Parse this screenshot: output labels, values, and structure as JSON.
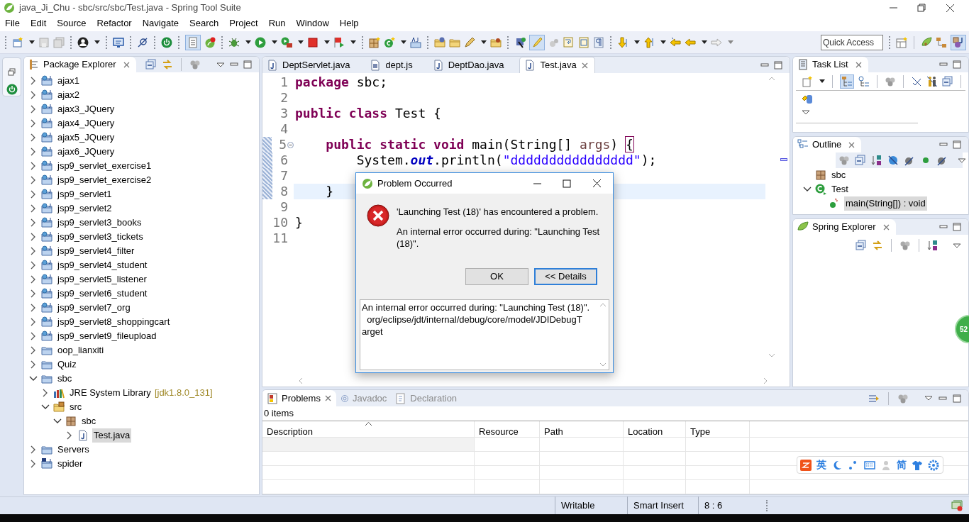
{
  "window": {
    "title": "java_Ji_Chu - sbc/src/sbc/Test.java - Spring Tool Suite"
  },
  "menu": [
    "File",
    "Edit",
    "Source",
    "Refactor",
    "Navigate",
    "Search",
    "Project",
    "Run",
    "Window",
    "Help"
  ],
  "quick_access": {
    "placeholder": "Quick Access"
  },
  "package_explorer": {
    "title": "Package Explorer",
    "tree": [
      {
        "label": "ajax1",
        "kind": "web_project",
        "expanded": false,
        "selected": false
      },
      {
        "label": "ajax2",
        "kind": "web_project",
        "expanded": false,
        "selected": false
      },
      {
        "label": "ajax3_JQuery",
        "kind": "web_project",
        "expanded": false,
        "selected": false
      },
      {
        "label": "ajax4_JQuery",
        "kind": "web_project",
        "expanded": false,
        "selected": false
      },
      {
        "label": "ajax5_JQuery",
        "kind": "web_project",
        "expanded": false,
        "selected": false
      },
      {
        "label": "ajax6_JQuery",
        "kind": "web_project",
        "expanded": false,
        "selected": false
      },
      {
        "label": "jsp9_servlet_exercise1",
        "kind": "web_project",
        "expanded": false,
        "selected": false
      },
      {
        "label": "jsp9_servlet_exercise2",
        "kind": "web_project",
        "expanded": false,
        "selected": false
      },
      {
        "label": "jsp9_servlet1",
        "kind": "web_project",
        "expanded": false,
        "selected": false
      },
      {
        "label": "jsp9_servlet2",
        "kind": "web_project",
        "expanded": false,
        "selected": false
      },
      {
        "label": "jsp9_servlet3_books",
        "kind": "web_project",
        "expanded": false,
        "selected": false
      },
      {
        "label": "jsp9_servlet3_tickets",
        "kind": "web_project",
        "expanded": false,
        "selected": false
      },
      {
        "label": "jsp9_servlet4_filter",
        "kind": "web_project",
        "expanded": false,
        "selected": false
      },
      {
        "label": "jsp9_servlet4_student",
        "kind": "web_project",
        "expanded": false,
        "selected": false
      },
      {
        "label": "jsp9_servlet5_listener",
        "kind": "web_project",
        "expanded": false,
        "selected": false
      },
      {
        "label": "jsp9_servlet6_student",
        "kind": "web_project",
        "expanded": false,
        "selected": false
      },
      {
        "label": "jsp9_servlet7_org",
        "kind": "web_project",
        "expanded": false,
        "selected": false
      },
      {
        "label": "jsp9_servlet8_shoppingcart",
        "kind": "web_project",
        "expanded": false,
        "selected": false
      },
      {
        "label": "jsp9_servlet9_fileupload",
        "kind": "web_project",
        "expanded": false,
        "selected": false
      },
      {
        "label": "oop_lianxiti",
        "kind": "project",
        "expanded": false,
        "selected": false
      },
      {
        "label": "Quiz",
        "kind": "project",
        "expanded": false,
        "selected": false
      },
      {
        "label": "sbc",
        "kind": "project",
        "expanded": true,
        "selected": false,
        "children": [
          {
            "label": "JRE System Library",
            "decoration": "[jdk1.8.0_131]",
            "kind": "library",
            "expanded": false,
            "selected": false
          },
          {
            "label": "src",
            "kind": "source_folder",
            "expanded": true,
            "selected": false,
            "children": [
              {
                "label": "sbc",
                "kind": "package",
                "expanded": true,
                "selected": false,
                "children": [
                  {
                    "label": "Test.java",
                    "kind": "java_file",
                    "expanded": false,
                    "selected": true
                  }
                ]
              }
            ]
          }
        ]
      },
      {
        "label": "Servers",
        "kind": "project",
        "expanded": false,
        "selected": false
      },
      {
        "label": "spider",
        "kind": "maven_project",
        "expanded": false,
        "selected": false
      }
    ]
  },
  "editor": {
    "tabs": [
      {
        "label": "DeptServlet.java",
        "kind": "java",
        "selected": false
      },
      {
        "label": "dept.js",
        "kind": "js",
        "selected": false
      },
      {
        "label": "DeptDao.java",
        "kind": "java",
        "selected": false
      },
      {
        "label": "Test.java",
        "kind": "java",
        "selected": true
      }
    ],
    "lines": [
      {
        "number": "1",
        "tokens": [
          {
            "kind": "keyword",
            "text": "package"
          },
          {
            "kind": "plain",
            "text": " sbc;"
          }
        ]
      },
      {
        "number": "2"
      },
      {
        "number": "3",
        "tokens": [
          {
            "kind": "keyword",
            "text": "public class"
          },
          {
            "kind": "plain",
            "text": " Test {"
          }
        ]
      },
      {
        "number": "4"
      },
      {
        "number": "5",
        "fold": true,
        "changed": true,
        "tokens": [
          {
            "kind": "keyword",
            "text": "    public static void"
          },
          {
            "kind": "plain",
            "text": " main(String[] "
          },
          {
            "kind": "param",
            "text": "args"
          },
          {
            "kind": "plain",
            "text": ") "
          },
          {
            "kind": "bracket",
            "text": "{"
          }
        ]
      },
      {
        "number": "6",
        "changed": true,
        "tokens": [
          {
            "kind": "plain",
            "text": "        System."
          },
          {
            "kind": "field",
            "text": "out"
          },
          {
            "kind": "plain",
            "text": ".println("
          },
          {
            "kind": "string",
            "text": "\"dddddddddddddddd\""
          },
          {
            "kind": "plain",
            "text": ");"
          }
        ]
      },
      {
        "number": "7",
        "changed": true
      },
      {
        "number": "8",
        "current": true,
        "changed": true,
        "tokens": [
          {
            "kind": "plain",
            "text": "    }"
          }
        ]
      },
      {
        "number": "9"
      },
      {
        "number": "10",
        "tokens": [
          {
            "kind": "plain",
            "text": "}"
          }
        ]
      },
      {
        "number": "11"
      }
    ]
  },
  "task_list": {
    "title": "Task List"
  },
  "outline": {
    "title": "Outline",
    "tree": [
      {
        "label": "sbc",
        "kind": "package",
        "selected": false
      },
      {
        "label": "Test",
        "kind": "class",
        "expanded": true,
        "selected": false,
        "children": [
          {
            "label": "main(String[]) : void",
            "kind": "method",
            "selected": true
          }
        ]
      }
    ]
  },
  "spring_explorer": {
    "title": "Spring Explorer"
  },
  "dialog": {
    "title": "Problem Occurred",
    "headline": "'Launching Test (18)' has encountered a problem.",
    "message": "An internal error occurred during: \"Launching Test (18)\".",
    "buttons": [
      {
        "label": "OK",
        "default": false
      },
      {
        "label": "<< Details",
        "default": true
      }
    ],
    "details": [
      "An internal error occurred during: \"Launching Test (18)\".",
      "  org/eclipse/jdt/internal/debug/core/model/JDIDebugT",
      "arget"
    ]
  },
  "problems": {
    "tabs": [
      {
        "label": "Problems",
        "selected": true
      },
      {
        "label": "Javadoc",
        "selected": false
      },
      {
        "label": "Declaration",
        "selected": false
      }
    ],
    "count": "0 items",
    "columns": [
      "Description",
      "Resource",
      "Path",
      "Location",
      "Type"
    ]
  },
  "status_bar": [
    "Writable",
    "Smart Insert",
    "8 : 6"
  ],
  "ime_bar": {
    "items": [
      "英",
      "简"
    ]
  },
  "side_badge": "52"
}
